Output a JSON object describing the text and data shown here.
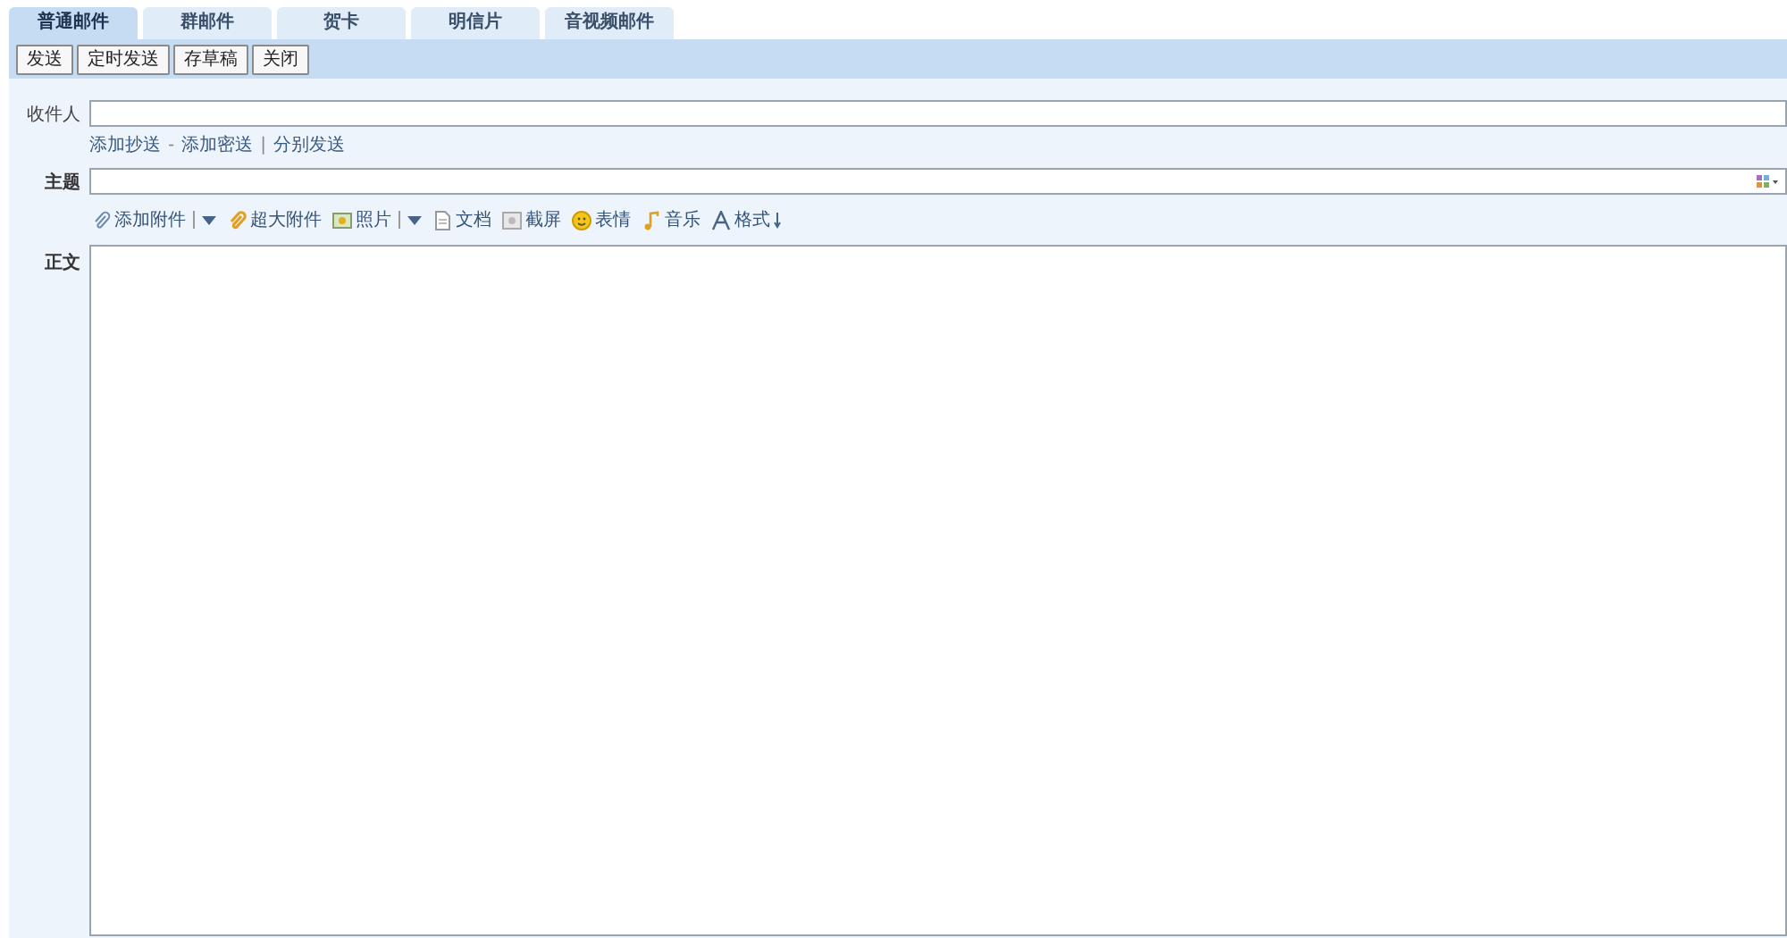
{
  "tabs": [
    {
      "label": "普通邮件",
      "selected": true
    },
    {
      "label": "群邮件",
      "selected": false
    },
    {
      "label": "贺卡",
      "selected": false
    },
    {
      "label": "明信片",
      "selected": false
    },
    {
      "label": "音视频邮件",
      "selected": false
    }
  ],
  "toolbar": [
    "发送",
    "定时发送",
    "存草稿",
    "关闭"
  ],
  "recipient": {
    "label": "收件人"
  },
  "recipient_links": [
    {
      "kind": "link",
      "text": "添加抄送"
    },
    {
      "kind": "sep",
      "text": "-"
    },
    {
      "kind": "link",
      "text": "添加密送"
    },
    {
      "kind": "sep",
      "text": "|"
    },
    {
      "kind": "link",
      "text": "分别发送"
    }
  ],
  "subject": {
    "label": "主题"
  },
  "editor_tools": [
    {
      "kind": "attach",
      "label": "添加附件",
      "dropdown": true
    },
    {
      "kind": "bigattach",
      "label": "超大附件",
      "dropdown": false
    },
    {
      "kind": "photo",
      "label": "照片",
      "dropdown": true
    },
    {
      "kind": "doc",
      "label": "文档",
      "dropdown": false
    },
    {
      "kind": "screenshot",
      "label": "截屏",
      "dropdown": false
    },
    {
      "kind": "emoji",
      "label": "表情",
      "dropdown": false
    },
    {
      "kind": "music",
      "label": "音乐",
      "dropdown": false
    },
    {
      "kind": "format",
      "label": "格式",
      "dropdown": false
    }
  ],
  "body": {
    "label": "正文"
  }
}
